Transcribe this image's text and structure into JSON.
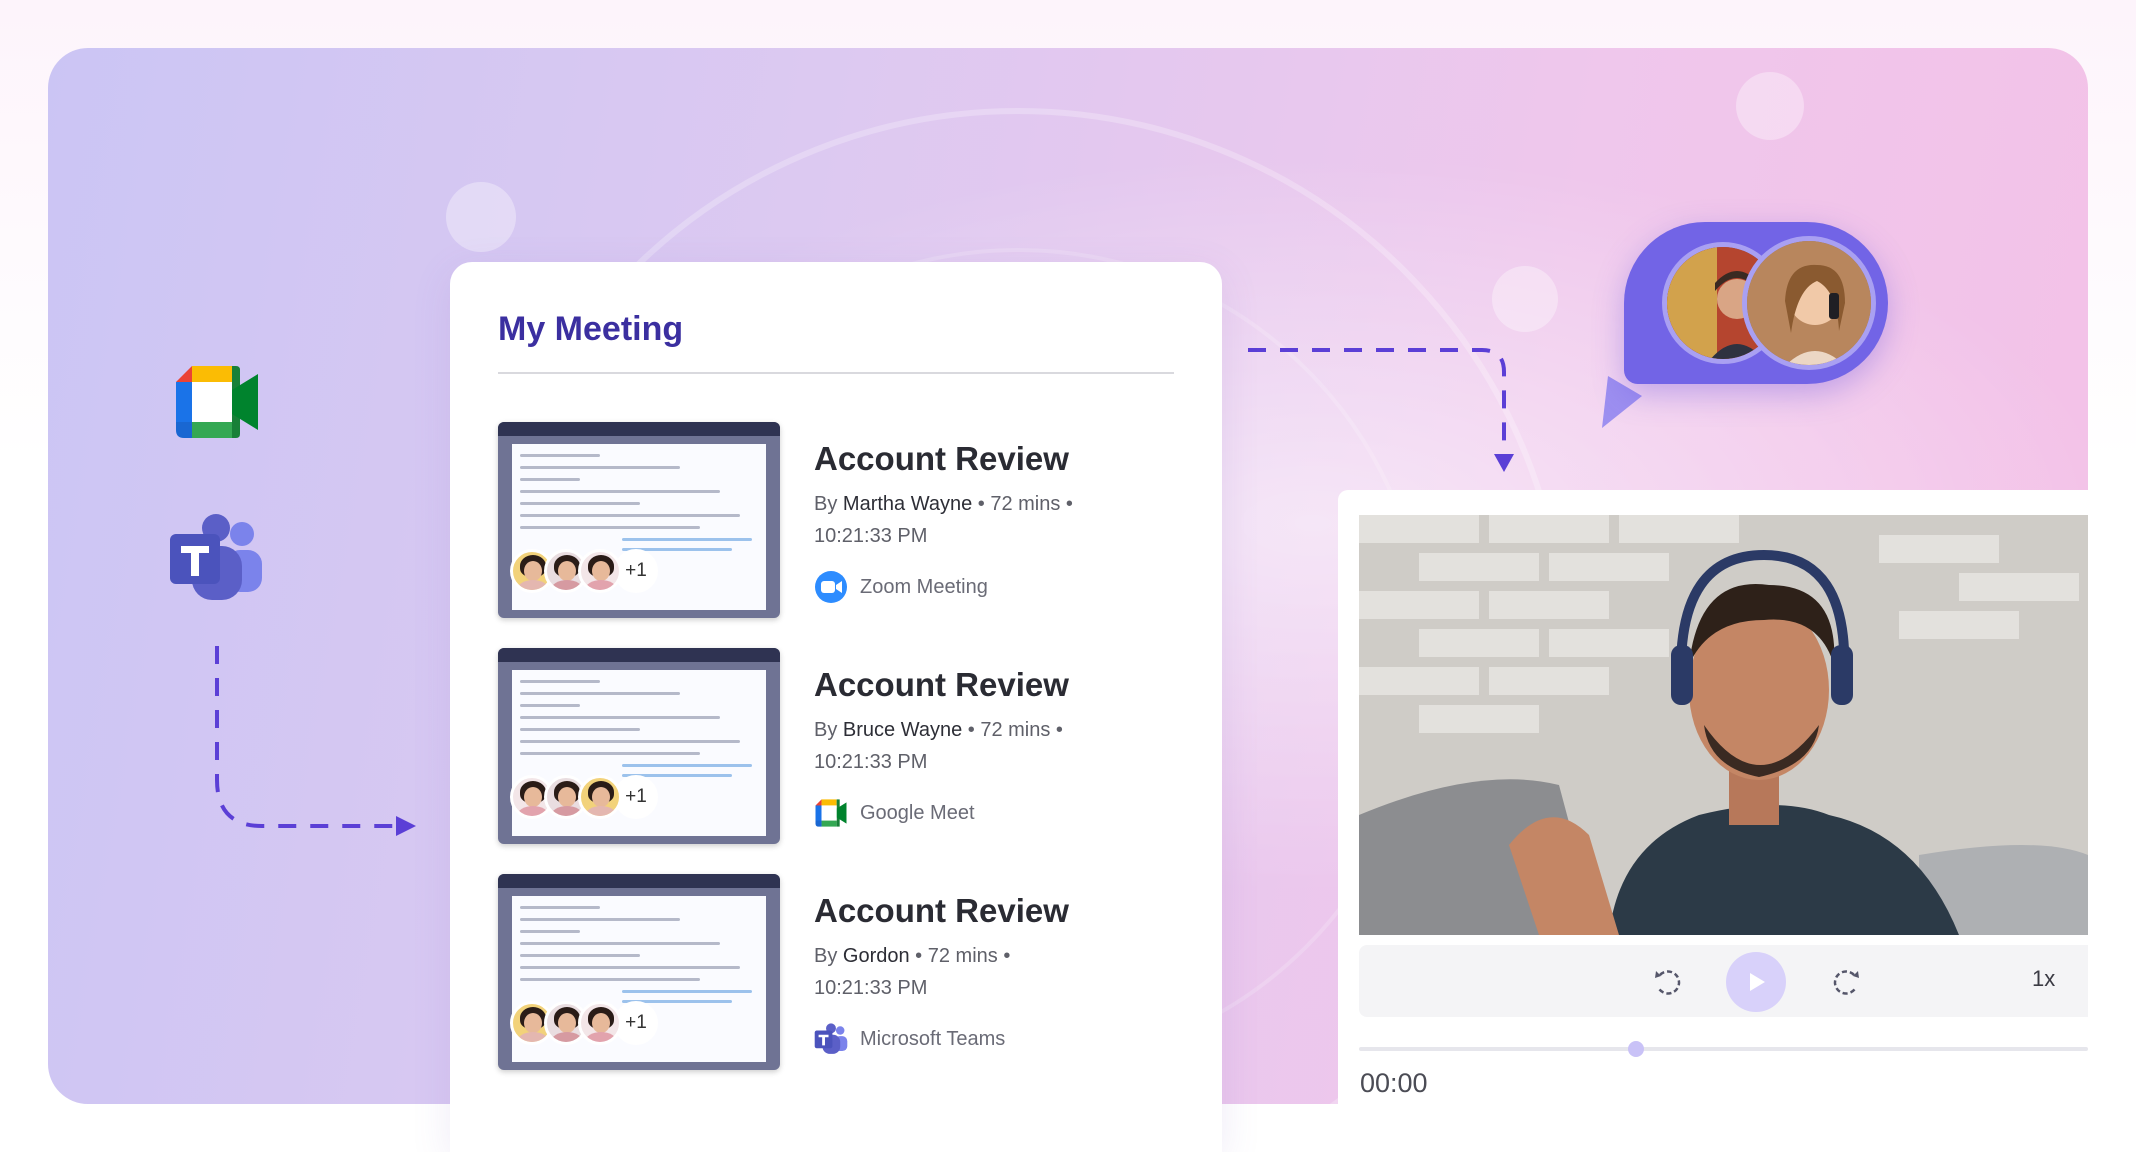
{
  "meeting_card": {
    "title": "My Meeting",
    "items": [
      {
        "title": "Account Review",
        "by_prefix": "By ",
        "author": "Martha Wayne",
        "duration": " • 72 mins •",
        "time": "10:21:33 PM",
        "platform": "Zoom Meeting",
        "platform_icon": "zoom-icon",
        "extra_participants": "+1"
      },
      {
        "title": "Account Review",
        "by_prefix": "By ",
        "author": "Bruce Wayne",
        "duration": " • 72 mins •",
        "time": "10:21:33 PM",
        "platform": "Google Meet",
        "platform_icon": "google-meet-icon",
        "extra_participants": "+1"
      },
      {
        "title": "Account Review",
        "by_prefix": "By ",
        "author": "Gordon",
        "duration": " • 72 mins •",
        "time": "10:21:33 PM",
        "platform": "Microsoft Teams",
        "platform_icon": "microsoft-teams-icon",
        "extra_participants": "+1"
      }
    ]
  },
  "left_apps": [
    {
      "name": "zoom",
      "icon": "zoom-icon"
    },
    {
      "name": "google-meet",
      "icon": "google-meet-icon"
    },
    {
      "name": "microsoft-teams",
      "icon": "microsoft-teams-icon"
    }
  ],
  "player": {
    "speed": "1x",
    "time": "00:00",
    "progress": 0.38
  },
  "colors": {
    "accent": "#3b2fa0",
    "bubble": "#7264e6",
    "arrow": "#5b3fd6",
    "zoom_blue": "#1a73f0",
    "teams_purple": "#5b5fc7"
  }
}
